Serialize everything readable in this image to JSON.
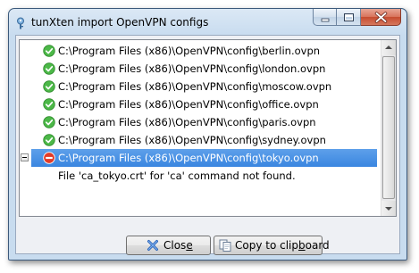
{
  "window": {
    "title": "tunXten import OpenVPN configs"
  },
  "list": {
    "items": [
      {
        "path": "C:\\Program Files (x86)\\OpenVPN\\config\\berlin.ovpn",
        "status": "ok"
      },
      {
        "path": "C:\\Program Files (x86)\\OpenVPN\\config\\london.ovpn",
        "status": "ok"
      },
      {
        "path": "C:\\Program Files (x86)\\OpenVPN\\config\\moscow.ovpn",
        "status": "ok"
      },
      {
        "path": "C:\\Program Files (x86)\\OpenVPN\\config\\office.ovpn",
        "status": "ok"
      },
      {
        "path": "C:\\Program Files (x86)\\OpenVPN\\config\\paris.ovpn",
        "status": "ok"
      },
      {
        "path": "C:\\Program Files (x86)\\OpenVPN\\config\\sydney.ovpn",
        "status": "ok"
      },
      {
        "path": "C:\\Program Files (x86)\\OpenVPN\\config\\tokyo.ovpn",
        "status": "error"
      }
    ],
    "error_detail": "File 'ca_tokyo.crt' for 'ca' command not found."
  },
  "buttons": {
    "close_pre": "Clos",
    "close_accel": "e",
    "copy_pre": "Copy to clip",
    "copy_accel": "b",
    "copy_post": "oard"
  },
  "colors": {
    "ok": "#3fae3a",
    "error": "#d8301f",
    "selection": "#3a86e0"
  }
}
